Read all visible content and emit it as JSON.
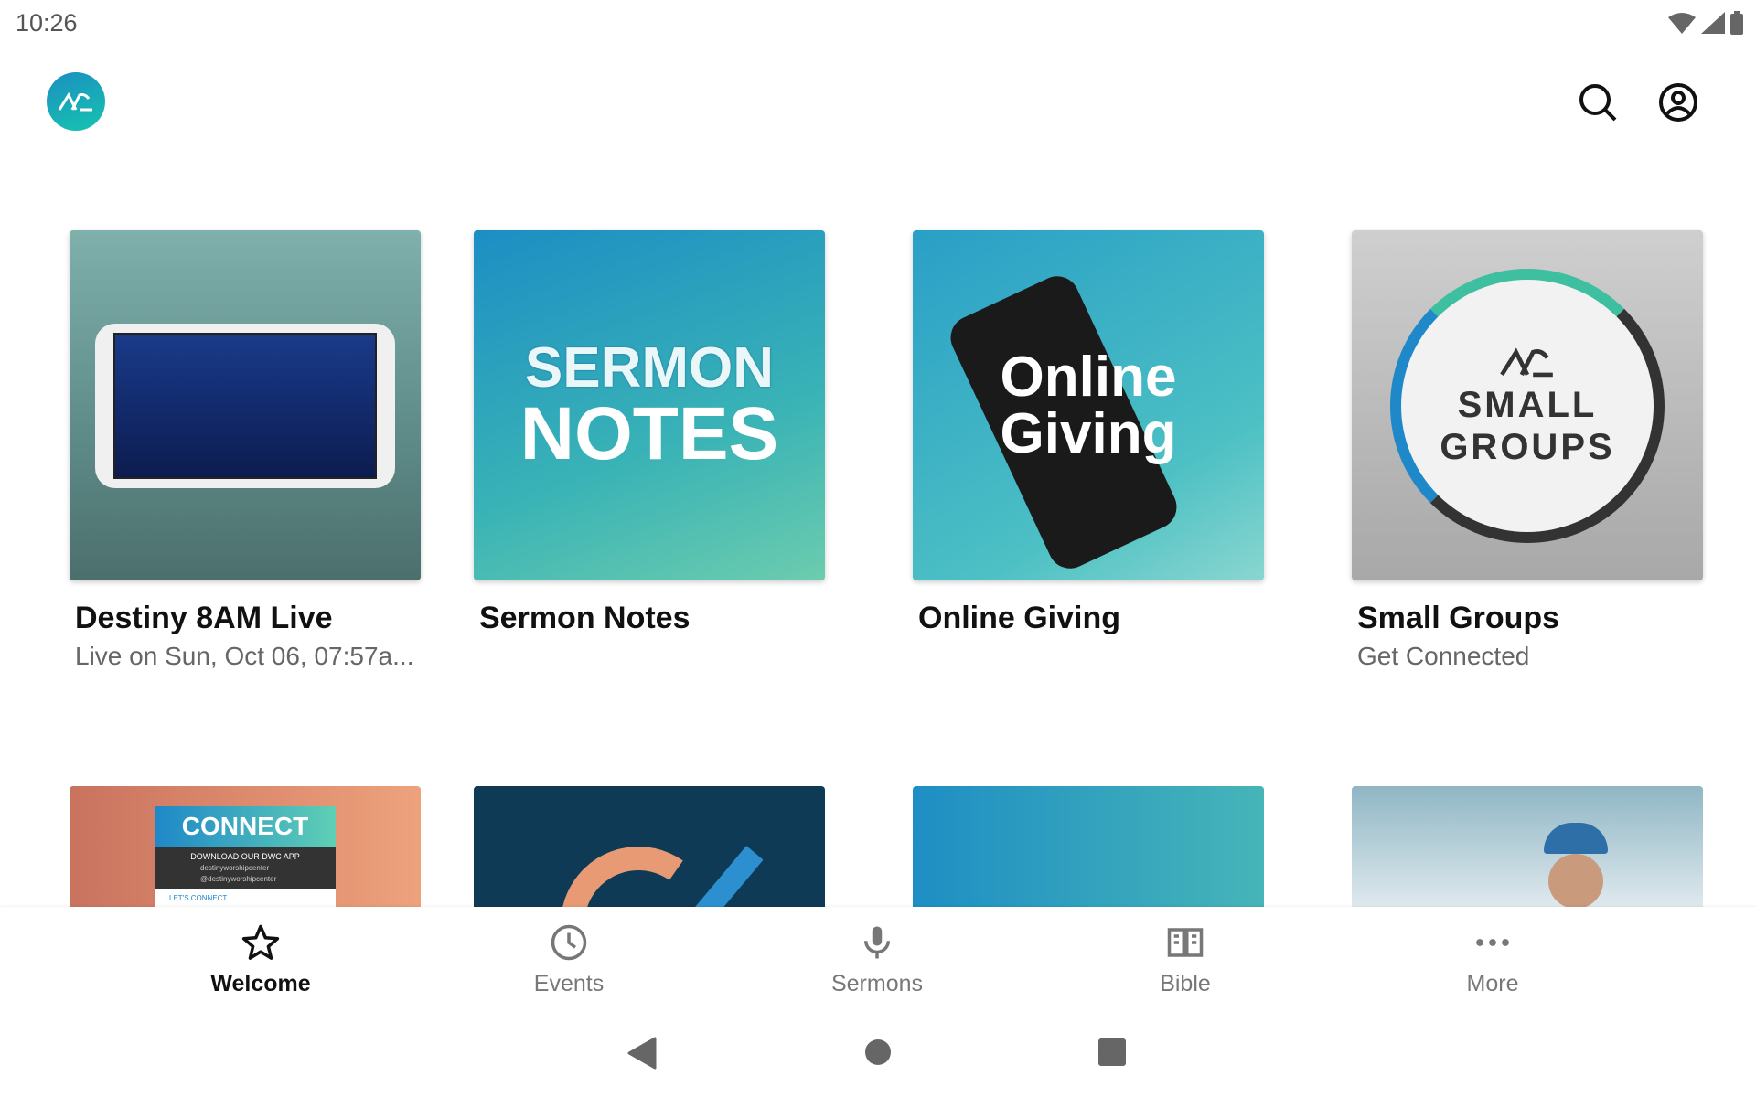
{
  "status_bar": {
    "time": "10:26",
    "icons": [
      "wifi-icon",
      "signal-icon",
      "battery-icon"
    ]
  },
  "header": {
    "logo": "DWC",
    "actions": [
      "search-icon",
      "account-icon"
    ]
  },
  "cards": [
    {
      "title": "Destiny 8AM Live",
      "subtitle": "Live on Sun, Oct 06, 07:57a...",
      "image": "tablet-livestream"
    },
    {
      "title": "Sermon Notes",
      "subtitle": "",
      "image_text": [
        "SERMON",
        "NOTES"
      ]
    },
    {
      "title": "Online Giving",
      "subtitle": "",
      "image_text": [
        "Online",
        "Giving"
      ]
    },
    {
      "title": "Small Groups",
      "subtitle": "Get Connected",
      "image_text": [
        "SMALL",
        "GROUPS"
      ]
    }
  ],
  "row2": [
    {
      "image_text": [
        "CONNECT",
        "DOWNLOAD OUR DWC APP",
        "destinyworshipcenter",
        "@destinyworshipcenter",
        "LET'S CONNECT"
      ]
    },
    {
      "image": "logo-arc"
    },
    {
      "image": "teal-pattern"
    },
    {
      "image": "people-celebrating"
    }
  ],
  "bottom_nav": [
    {
      "label": "Welcome",
      "icon": "star-icon",
      "active": true
    },
    {
      "label": "Events",
      "icon": "clock-icon"
    },
    {
      "label": "Sermons",
      "icon": "microphone-icon"
    },
    {
      "label": "Bible",
      "icon": "book-icon"
    },
    {
      "label": "More",
      "icon": "more-icon"
    }
  ],
  "colors": {
    "accent": "#16b0b8",
    "active": "#111111",
    "inactive": "#777777"
  }
}
